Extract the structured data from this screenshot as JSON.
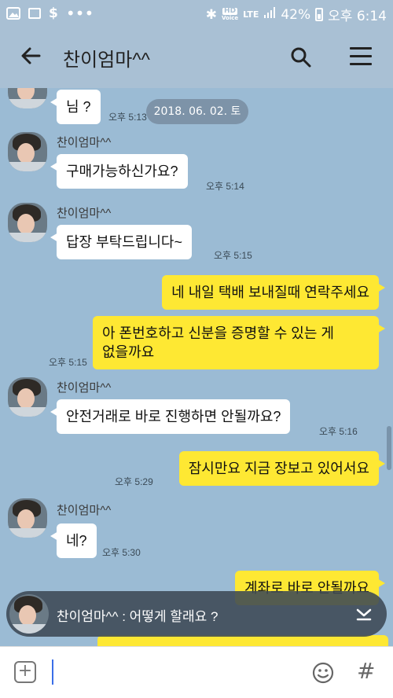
{
  "status_bar": {
    "battery": "42%",
    "time": "오후 6:14",
    "network": "LTE",
    "hd_label": "HD",
    "voice_label": "Voice"
  },
  "header": {
    "title": "찬이엄마^^"
  },
  "chat": {
    "date_pill": "2018. 06. 02. 토",
    "messages": [
      {
        "side": "in",
        "text": "님 ?",
        "time": "오후 5:13",
        "show_name": false
      },
      {
        "side": "in",
        "name": "찬이엄마^^",
        "text": "구매가능하신가요?",
        "time": "오후 5:14",
        "show_name": true
      },
      {
        "side": "in",
        "name": "찬이엄마^^",
        "text": "답장 부탁드립니다~",
        "time": "오후 5:15",
        "show_name": true
      },
      {
        "side": "out",
        "text": "네 내일 택배 보내질때 연락주세요",
        "time": ""
      },
      {
        "side": "out",
        "text_line1": "아 폰번호하고 신분을 증명할 수 있는 게",
        "text_line2": "없을까요",
        "time": "오후 5:15"
      },
      {
        "side": "in",
        "name": "찬이엄마^^",
        "text": "안전거래로 바로 진행하면 안될까요?",
        "time": "오후 5:16",
        "show_name": true
      },
      {
        "side": "out",
        "text": "잠시만요 지금 장보고 있어서요",
        "time": "오후 5:29"
      },
      {
        "side": "in",
        "name": "찬이엄마^^",
        "text": "네?",
        "time": "오후 5:30",
        "show_name": true
      },
      {
        "side": "out",
        "text": "계좌로 바로 안될까요",
        "time": ""
      }
    ]
  },
  "notification": {
    "text": "찬이엄마^^ : 어떻게 할래요 ?"
  },
  "colors": {
    "chat_bg": "#9bbbd4",
    "bubble_out": "#fee833",
    "bubble_in": "#ffffff"
  },
  "icons": [
    "back-arrow-icon",
    "search-icon",
    "menu-icon",
    "add-icon",
    "emoji-icon",
    "hash-icon",
    "chevron-down-icon"
  ]
}
